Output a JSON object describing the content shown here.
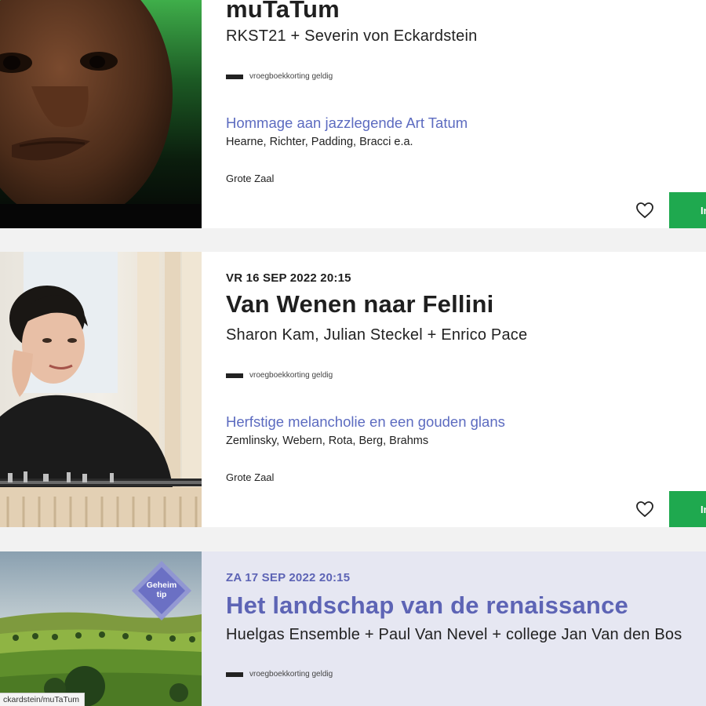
{
  "events": [
    {
      "date": "",
      "title": "muTaTum",
      "performers": "RKST21 + Severin von Eckardstein",
      "discount_label": "vroegboekkorting geldig",
      "tagline": "Hommage aan jazzlegende Art Tatum",
      "composers": "Hearne, Richter, Padding, Bracci e.a.",
      "venue": "Grote Zaal",
      "buy_label": "In"
    },
    {
      "date": "VR 16 SEP 2022 20:15",
      "title": "Van Wenen naar Fellini",
      "performers": "Sharon Kam, Julian Steckel + Enrico Pace",
      "discount_label": "vroegboekkorting geldig",
      "tagline": "Herfstige melancholie en een gouden glans",
      "composers": "Zemlinsky, Webern, Rota, Berg, Brahms",
      "venue": "Grote Zaal",
      "buy_label": "In"
    },
    {
      "date": "ZA 17 SEP 2022 20:15",
      "title": "Het landschap van de renaissance",
      "performers": "Huelgas Ensemble + Paul Van Nevel + college Jan Van den Bos",
      "discount_label": "vroegboekkorting geldig",
      "badge_line1": "Geheim",
      "badge_line2": "tip"
    }
  ],
  "status_url": "ckardstein/muTaTum",
  "icons": {
    "favorite": "heart-outline-icon",
    "discount": "discount-tag-icon"
  },
  "colors": {
    "accent_blue": "#5c6bc0",
    "buy_green": "#1fa94f",
    "tip_bg": "#e6e7f2"
  }
}
